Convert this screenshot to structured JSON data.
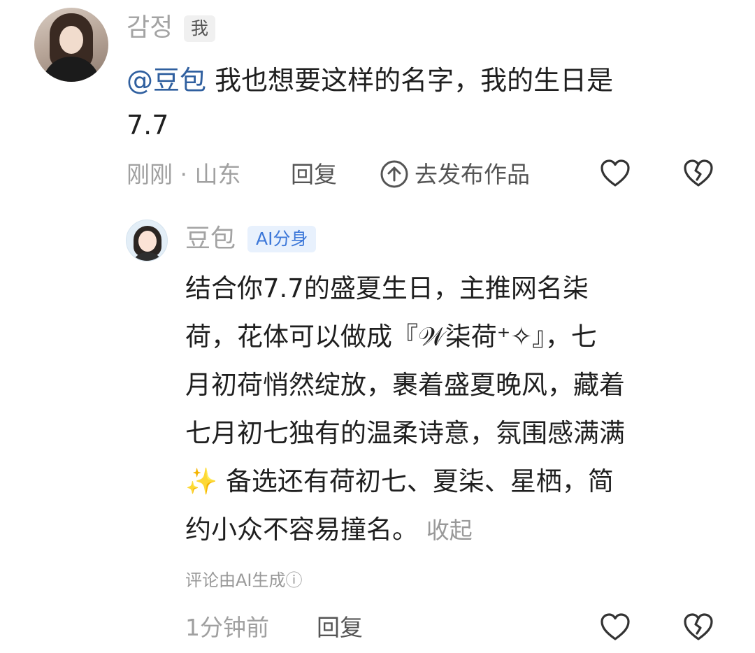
{
  "comment": {
    "username": "감정",
    "badge": "我",
    "mention": "@豆包",
    "text": " 我也想要这样的名字，我的生日是",
    "text_line2": "7.7",
    "time_location": "刚刚 · 山东",
    "reply_label": "回复",
    "publish_label": "去发布作品"
  },
  "reply": {
    "username": "豆包",
    "badge": "AI分身",
    "lines": [
      "结合你7.7的盛夏生日，主推网名柒",
      "荷，花体可以做成『𝒲柒荷⁺✧』，七",
      "月初荷悄然绽放，裹着盛夏晚风，藏着",
      "七月初七独有的温柔诗意，氛围感满满",
      "✨ 备选还有荷初七、夏柒、星栖，简",
      "约小众不容易撞名。"
    ],
    "collapse_label": "收起",
    "ai_note": "评论由AI生成ⓘ",
    "time": "1分钟前",
    "reply_label": "回复"
  },
  "icons": {
    "like": "heart-icon",
    "dislike": "broken-heart-icon",
    "publish": "up-arrow-circle-icon"
  }
}
